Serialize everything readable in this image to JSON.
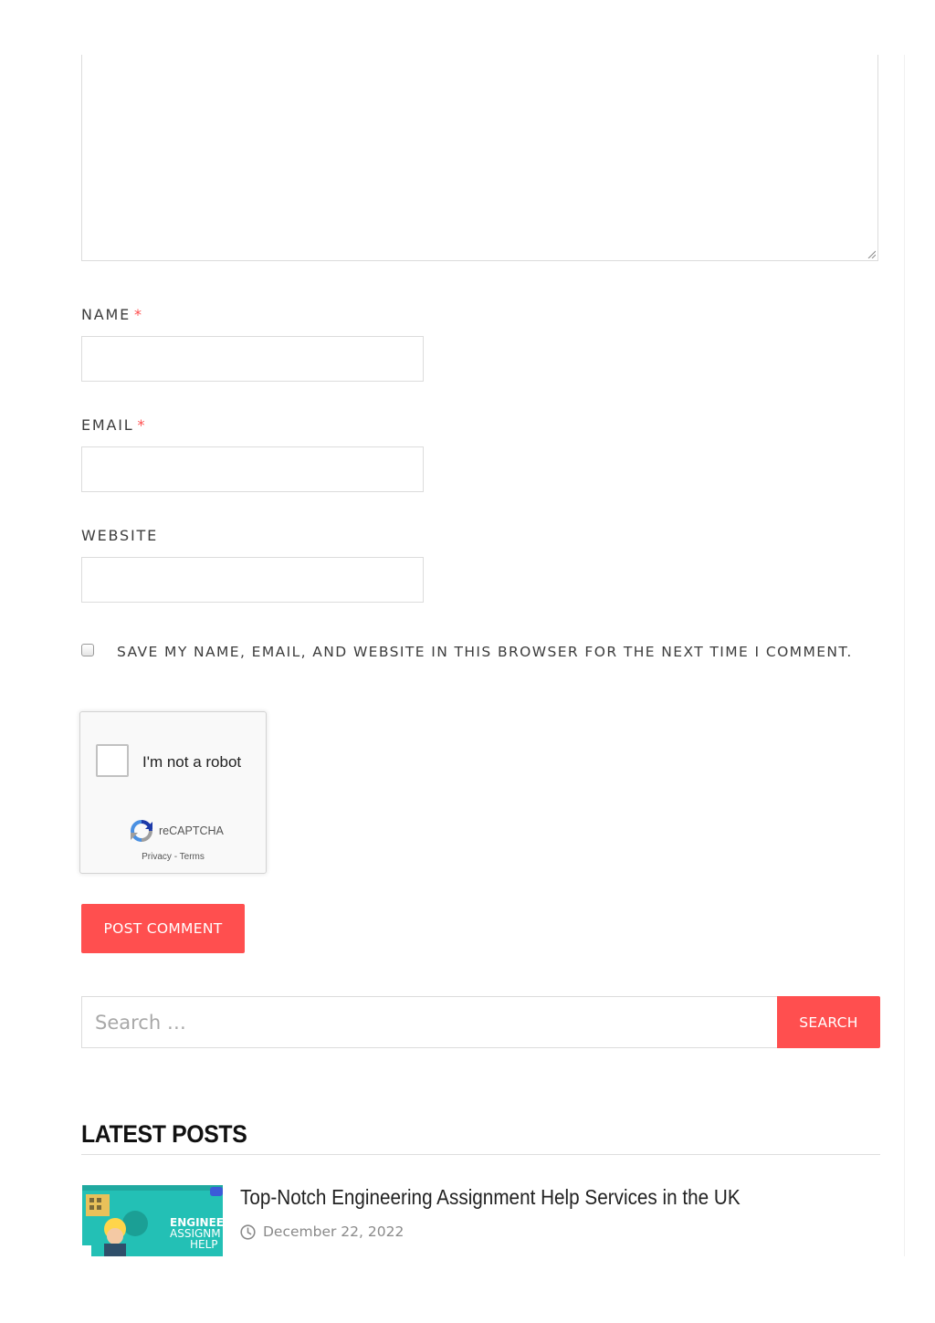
{
  "comment_form": {
    "name_label": "NAME",
    "email_label": "EMAIL",
    "website_label": "WEBSITE",
    "required_mark": "*",
    "save_consent_label": "SAVE MY NAME, EMAIL, AND WEBSITE IN THIS BROWSER FOR THE NEXT TIME I COMMENT.",
    "submit_label": "POST COMMENT"
  },
  "recaptcha": {
    "checkbox_label": "I'm not a robot",
    "brand": "reCAPTCHA",
    "privacy_link": "Privacy",
    "separator": "-",
    "terms_link": "Terms"
  },
  "search": {
    "placeholder": "Search …",
    "button_label": "SEARCH"
  },
  "latest_posts": {
    "heading": "LATEST POSTS",
    "posts": [
      {
        "title": "Top-Notch Engineering Assignment Help Services in the UK",
        "date": "December 22, 2022",
        "thumb_text": [
          "ENGINEER",
          "ASSIGNM",
          "HELP"
        ]
      }
    ]
  },
  "colors": {
    "accent": "#ff4f4f",
    "thumb_bg": "#23c0b5"
  }
}
